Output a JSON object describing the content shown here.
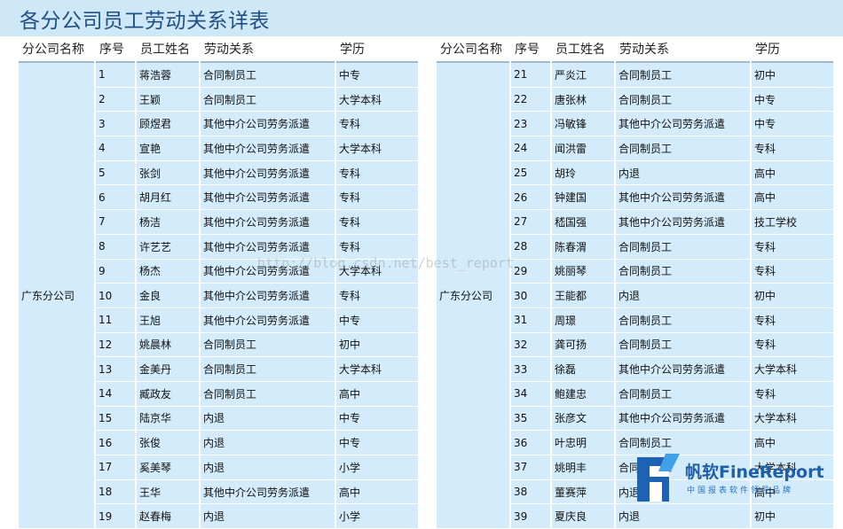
{
  "page": {
    "title": "各分公司员工劳动关系详表"
  },
  "columns": [
    "分公司名称",
    "序号",
    "员工姓名",
    "劳动关系",
    "学历"
  ],
  "left_table": {
    "company": "广东分公司",
    "rows": [
      [
        "1",
        "蒋浩蓉",
        "合同制员工",
        "中专"
      ],
      [
        "2",
        "王颖",
        "合同制员工",
        "大学本科"
      ],
      [
        "3",
        "顾煜君",
        "其他中介公司劳务派遣",
        "专科"
      ],
      [
        "4",
        "宣艳",
        "其他中介公司劳务派遣",
        "大学本科"
      ],
      [
        "5",
        "张剑",
        "其他中介公司劳务派遣",
        "专科"
      ],
      [
        "6",
        "胡月红",
        "其他中介公司劳务派遣",
        "专科"
      ],
      [
        "7",
        "杨洁",
        "其他中介公司劳务派遣",
        "专科"
      ],
      [
        "8",
        "许艺艺",
        "其他中介公司劳务派遣",
        "专科"
      ],
      [
        "9",
        "杨杰",
        "其他中介公司劳务派遣",
        "大学本科"
      ],
      [
        "10",
        "金良",
        "其他中介公司劳务派遣",
        "专科"
      ],
      [
        "11",
        "王旭",
        "其他中介公司劳务派遣",
        "中专"
      ],
      [
        "12",
        "姚晨林",
        "合同制员工",
        "初中"
      ],
      [
        "13",
        "金美丹",
        "合同制员工",
        "大学本科"
      ],
      [
        "14",
        "臧政友",
        "合同制员工",
        "高中"
      ],
      [
        "15",
        "陆京华",
        "内退",
        "中专"
      ],
      [
        "16",
        "张俊",
        "内退",
        "中专"
      ],
      [
        "17",
        "奚美琴",
        "内退",
        "小学"
      ],
      [
        "18",
        "王华",
        "其他中介公司劳务派遣",
        "高中"
      ],
      [
        "19",
        "赵春梅",
        "内退",
        "小学"
      ]
    ]
  },
  "right_table": {
    "company": "广东分公司",
    "rows": [
      [
        "21",
        "严炎江",
        "合同制员工",
        "初中"
      ],
      [
        "22",
        "唐张林",
        "合同制员工",
        "中专"
      ],
      [
        "23",
        "冯敏锋",
        "其他中介公司劳务派遣",
        "中专"
      ],
      [
        "24",
        "闻洪雷",
        "合同制员工",
        "专科"
      ],
      [
        "25",
        "胡玲",
        "内退",
        "高中"
      ],
      [
        "26",
        "钟建国",
        "其他中介公司劳务派遣",
        "高中"
      ],
      [
        "27",
        "嵇国强",
        "其他中介公司劳务派遣",
        "技工学校"
      ],
      [
        "28",
        "陈春渭",
        "合同制员工",
        "专科"
      ],
      [
        "29",
        "姚丽琴",
        "合同制员工",
        "专科"
      ],
      [
        "30",
        "王能都",
        "内退",
        "初中"
      ],
      [
        "31",
        "周璟",
        "合同制员工",
        "专科"
      ],
      [
        "32",
        "龚可扬",
        "合同制员工",
        "专科"
      ],
      [
        "33",
        "徐磊",
        "其他中介公司劳务派遣",
        "大学本科"
      ],
      [
        "34",
        "鲍建忠",
        "合同制员工",
        "专科"
      ],
      [
        "35",
        "张彦文",
        "其他中介公司劳务派遣",
        "大学本科"
      ],
      [
        "36",
        "叶忠明",
        "合同制员工",
        "高中"
      ],
      [
        "37",
        "姚明丰",
        "合同制员工",
        "大学本科"
      ],
      [
        "38",
        "董赛萍",
        "内退",
        "高中"
      ],
      [
        "39",
        "夏庆良",
        "内退",
        "初中"
      ]
    ]
  },
  "watermark": "http://blog.csdn.net/best_report",
  "logo": {
    "name": "帆软FineReport",
    "tagline": "中国报表软件领导品牌"
  }
}
